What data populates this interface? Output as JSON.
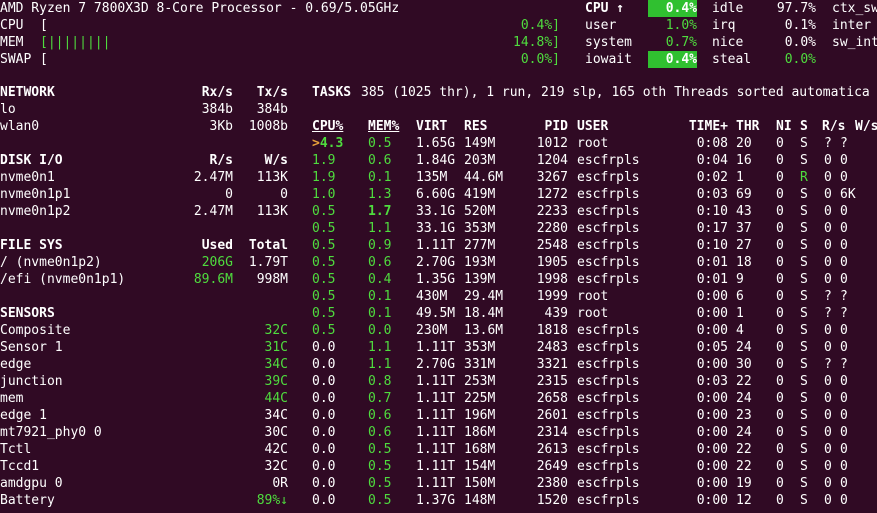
{
  "header": {
    "cpu_model": "AMD Ryzen 7 7800X3D 8-Core Processor - 0.69/5.05GHz",
    "cpu_label": "CPU",
    "cpu_bracket": "[",
    "cpu_pct": "0.4%]",
    "mem_label": "MEM",
    "mem_bracket": "[||||||||",
    "mem_pct": "14.8%]",
    "swap_label": "SWAP",
    "swap_bracket": "[",
    "swap_pct": "0.0%]"
  },
  "cpu_panel": {
    "title": "CPU ↑",
    "total": "0.4%",
    "user_label": "user",
    "user": "1.0%",
    "system_label": "system",
    "system": "0.7%",
    "iowait_label": "iowait",
    "iowait": "0.4%",
    "idle_label": "idle",
    "idle": "97.7%",
    "irq_label": "irq",
    "irq": "0.1%",
    "nice_label": "nice",
    "nice": "0.0%",
    "steal_label": "steal",
    "steal": "0.0%",
    "ctx_sw_label": "ctx_sw",
    "inter_label": "inter",
    "sw_int_label": "sw_int"
  },
  "network": {
    "title": "NETWORK",
    "rx_label": "Rx/s",
    "tx_label": "Tx/s",
    "rows": [
      {
        "name": "lo",
        "rx": "384b",
        "tx": "384b"
      },
      {
        "name": "wlan0",
        "rx": "3Kb",
        "tx": "1008b"
      }
    ]
  },
  "disk": {
    "title": "DISK I/O",
    "r_label": "R/s",
    "w_label": "W/s",
    "rows": [
      {
        "name": "nvme0n1",
        "r": "2.47M",
        "w": "113K"
      },
      {
        "name": "nvme0n1p1",
        "r": "0",
        "w": "0"
      },
      {
        "name": "nvme0n1p2",
        "r": "2.47M",
        "w": "113K"
      }
    ]
  },
  "filesys": {
    "title": "FILE SYS",
    "used_label": "Used",
    "total_label": "Total",
    "rows": [
      {
        "name": "/ (nvme0n1p2)",
        "used": "206G",
        "total": "1.79T"
      },
      {
        "name": "/efi (nvme0n1p1)",
        "used": "89.6M",
        "total": "998M"
      }
    ]
  },
  "sensors": {
    "title": "SENSORS",
    "rows": [
      {
        "name": "Composite",
        "value": "32C",
        "ok": true
      },
      {
        "name": "Sensor 1",
        "value": "31C",
        "ok": true
      },
      {
        "name": "edge",
        "value": "34C",
        "ok": true
      },
      {
        "name": "junction",
        "value": "39C",
        "ok": true
      },
      {
        "name": "mem",
        "value": "44C",
        "ok": true
      },
      {
        "name": "edge 1",
        "value": "34C",
        "ok": false
      },
      {
        "name": "mt7921_phy0 0",
        "value": "30C",
        "ok": false
      },
      {
        "name": "Tctl",
        "value": "42C",
        "ok": false
      },
      {
        "name": "Tccd1",
        "value": "32C",
        "ok": false
      },
      {
        "name": "amdgpu 0",
        "value": "0R",
        "ok": false
      },
      {
        "name": "Battery",
        "value": "89%↓",
        "ok": true
      }
    ]
  },
  "tasks": {
    "summary_label": "TASKS",
    "summary": "385 (1025 thr), 1 run, 219 slp, 165 oth Threads sorted automatica",
    "columns": [
      "CPU%",
      "MEM%",
      "VIRT",
      "RES",
      "PID",
      "USER",
      "TIME+",
      "THR",
      "NI",
      "S",
      "R/s",
      "W/s"
    ],
    "rows": [
      {
        "cpu": ">4.3",
        "mem": "0.5",
        "virt": "1.65G",
        "res": "149M",
        "pid": "1012",
        "user": "root",
        "time": "0:08",
        "thr": "20",
        "ni": "0",
        "s": "S",
        "rs": "?",
        "ws": "?"
      },
      {
        "cpu": "1.9",
        "mem": "0.6",
        "virt": "1.84G",
        "res": "203M",
        "pid": "1204",
        "user": "escfrpls",
        "time": "0:04",
        "thr": "16",
        "ni": "0",
        "s": "S",
        "rs": "0",
        "ws": "0"
      },
      {
        "cpu": "1.9",
        "mem": "0.1",
        "virt": "135M",
        "res": "44.6M",
        "pid": "3267",
        "user": "escfrpls",
        "time": "0:02",
        "thr": "1",
        "ni": "0",
        "s": "R",
        "rs": "0",
        "ws": "0"
      },
      {
        "cpu": "1.0",
        "mem": "1.3",
        "virt": "6.60G",
        "res": "419M",
        "pid": "1272",
        "user": "escfrpls",
        "time": "0:03",
        "thr": "69",
        "ni": "0",
        "s": "S",
        "rs": "0",
        "ws": "6K"
      },
      {
        "cpu": "0.5",
        "mem": "1.7",
        "virt": "33.1G",
        "res": "520M",
        "pid": "2233",
        "user": "escfrpls",
        "time": "0:10",
        "thr": "43",
        "ni": "0",
        "s": "S",
        "rs": "0",
        "ws": "0"
      },
      {
        "cpu": "0.5",
        "mem": "1.1",
        "virt": "33.1G",
        "res": "353M",
        "pid": "2280",
        "user": "escfrpls",
        "time": "0:17",
        "thr": "37",
        "ni": "0",
        "s": "S",
        "rs": "0",
        "ws": "0"
      },
      {
        "cpu": "0.5",
        "mem": "0.9",
        "virt": "1.11T",
        "res": "277M",
        "pid": "2548",
        "user": "escfrpls",
        "time": "0:10",
        "thr": "27",
        "ni": "0",
        "s": "S",
        "rs": "0",
        "ws": "0"
      },
      {
        "cpu": "0.5",
        "mem": "0.6",
        "virt": "2.70G",
        "res": "193M",
        "pid": "1905",
        "user": "escfrpls",
        "time": "0:01",
        "thr": "18",
        "ni": "0",
        "s": "S",
        "rs": "0",
        "ws": "0"
      },
      {
        "cpu": "0.5",
        "mem": "0.4",
        "virt": "1.35G",
        "res": "139M",
        "pid": "1998",
        "user": "escfrpls",
        "time": "0:01",
        "thr": "9",
        "ni": "0",
        "s": "S",
        "rs": "0",
        "ws": "0"
      },
      {
        "cpu": "0.5",
        "mem": "0.1",
        "virt": "430M",
        "res": "29.4M",
        "pid": "1999",
        "user": "root",
        "time": "0:00",
        "thr": "6",
        "ni": "0",
        "s": "S",
        "rs": "?",
        "ws": "?"
      },
      {
        "cpu": "0.5",
        "mem": "0.1",
        "virt": "49.5M",
        "res": "18.4M",
        "pid": "439",
        "user": "root",
        "time": "0:00",
        "thr": "1",
        "ni": "0",
        "s": "S",
        "rs": "?",
        "ws": "?"
      },
      {
        "cpu": "0.5",
        "mem": "0.0",
        "virt": "230M",
        "res": "13.6M",
        "pid": "1818",
        "user": "escfrpls",
        "time": "0:00",
        "thr": "4",
        "ni": "0",
        "s": "S",
        "rs": "0",
        "ws": "0"
      },
      {
        "cpu": "0.0",
        "mem": "1.1",
        "virt": "1.11T",
        "res": "353M",
        "pid": "2483",
        "user": "escfrpls",
        "time": "0:05",
        "thr": "24",
        "ni": "0",
        "s": "S",
        "rs": "0",
        "ws": "0"
      },
      {
        "cpu": "0.0",
        "mem": "1.1",
        "virt": "2.70G",
        "res": "331M",
        "pid": "3321",
        "user": "escfrpls",
        "time": "0:00",
        "thr": "30",
        "ni": "0",
        "s": "S",
        "rs": "?",
        "ws": "?"
      },
      {
        "cpu": "0.0",
        "mem": "0.8",
        "virt": "1.11T",
        "res": "253M",
        "pid": "2315",
        "user": "escfrpls",
        "time": "0:03",
        "thr": "22",
        "ni": "0",
        "s": "S",
        "rs": "0",
        "ws": "0"
      },
      {
        "cpu": "0.0",
        "mem": "0.7",
        "virt": "1.11T",
        "res": "225M",
        "pid": "2658",
        "user": "escfrpls",
        "time": "0:00",
        "thr": "24",
        "ni": "0",
        "s": "S",
        "rs": "0",
        "ws": "0"
      },
      {
        "cpu": "0.0",
        "mem": "0.6",
        "virt": "1.11T",
        "res": "196M",
        "pid": "2601",
        "user": "escfrpls",
        "time": "0:00",
        "thr": "23",
        "ni": "0",
        "s": "S",
        "rs": "0",
        "ws": "0"
      },
      {
        "cpu": "0.0",
        "mem": "0.6",
        "virt": "1.11T",
        "res": "186M",
        "pid": "2314",
        "user": "escfrpls",
        "time": "0:00",
        "thr": "24",
        "ni": "0",
        "s": "S",
        "rs": "0",
        "ws": "0"
      },
      {
        "cpu": "0.0",
        "mem": "0.5",
        "virt": "1.11T",
        "res": "168M",
        "pid": "2613",
        "user": "escfrpls",
        "time": "0:00",
        "thr": "22",
        "ni": "0",
        "s": "S",
        "rs": "0",
        "ws": "0"
      },
      {
        "cpu": "0.0",
        "mem": "0.5",
        "virt": "1.11T",
        "res": "154M",
        "pid": "2649",
        "user": "escfrpls",
        "time": "0:00",
        "thr": "22",
        "ni": "0",
        "s": "S",
        "rs": "0",
        "ws": "0"
      },
      {
        "cpu": "0.0",
        "mem": "0.5",
        "virt": "1.11T",
        "res": "150M",
        "pid": "2380",
        "user": "escfrpls",
        "time": "0:00",
        "thr": "19",
        "ni": "0",
        "s": "S",
        "rs": "0",
        "ws": "0"
      },
      {
        "cpu": "0.0",
        "mem": "0.5",
        "virt": "1.37G",
        "res": "148M",
        "pid": "1520",
        "user": "escfrpls",
        "time": "0:00",
        "thr": "12",
        "ni": "0",
        "s": "S",
        "rs": "0",
        "ws": "0"
      }
    ]
  },
  "colors": {
    "background": "#300a24",
    "text": "#ffffff",
    "ok_green": "#4fdc3e",
    "highlight": "#30c030",
    "accent_orange": "#e8a13a"
  }
}
